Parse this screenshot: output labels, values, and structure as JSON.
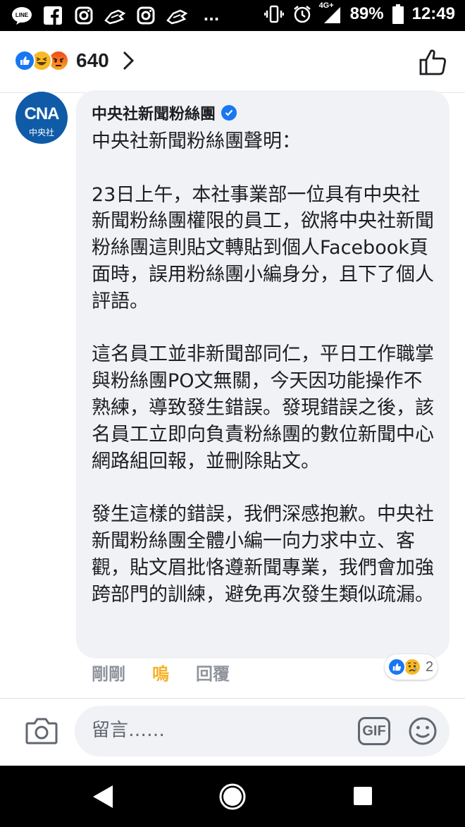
{
  "status_bar": {
    "network": "4G+",
    "battery": "89%",
    "time": "12:49",
    "line_label": "LINE",
    "more": "..."
  },
  "reactions": {
    "count": "640",
    "types": [
      "like-icon",
      "haha-icon",
      "angry-icon"
    ]
  },
  "comment": {
    "author": "中央社新聞粉絲團",
    "avatar_logo": "CNA",
    "avatar_sub": "中央社",
    "paragraphs": [
      "中央社新聞粉絲團聲明：",
      "23日上午，本社事業部一位具有中央社新聞粉絲團權限的員工，欲將中央社新聞粉絲團這則貼文轉貼到個人Facebook頁面時，誤用粉絲團小編身分，且下了個人評語。",
      "這名員工並非新聞部同仁，平日工作職掌與粉絲團PO文無關，今天因功能操作不熟練，導致發生錯誤。發現錯誤之後，該名員工立即向負責粉絲團的數位新聞中心網路組回報，並刪除貼文。",
      "發生這樣的錯誤，我們深感抱歉。中央社新聞粉絲團全體小編一向力求中立、客觀，貼文眉批恪遵新聞專業，我們會加強跨部門的訓練，避免再次發生類似疏漏。"
    ],
    "time": "剛剛",
    "reaction_label": "嗚",
    "reply_label": "回覆",
    "reaction_count": "2"
  },
  "composer": {
    "placeholder": "留言……",
    "gif_label": "GIF"
  },
  "colors": {
    "facebook_blue": "#1877f2",
    "reaction_yellow": "#f7b125",
    "bubble_gray": "#f0f2f5"
  }
}
